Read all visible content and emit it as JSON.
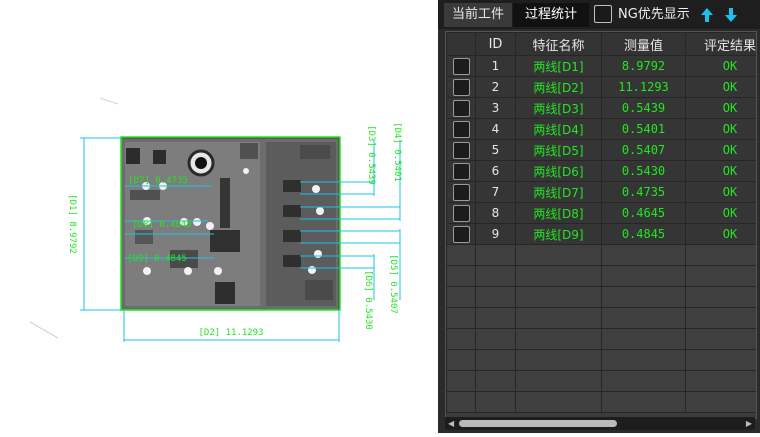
{
  "tabs": [
    {
      "label": "当前工件"
    },
    {
      "label": "过程统计"
    }
  ],
  "ng_toggle": {
    "label": "NG优先显示",
    "checked": false
  },
  "icons": {
    "up": "arrow-up-icon",
    "down": "arrow-down-icon"
  },
  "colors": {
    "ok_text": "#22e622",
    "annotation": "#22e622",
    "measure_line": "#19c3e6"
  },
  "table": {
    "headers": [
      "",
      "ID",
      "特征名称",
      "测量值",
      "评定结果"
    ],
    "rows": [
      {
        "id": "1",
        "name": "两线[D1]",
        "value": "8.9792",
        "result": "OK"
      },
      {
        "id": "2",
        "name": "两线[D2]",
        "value": "11.1293",
        "result": "OK"
      },
      {
        "id": "3",
        "name": "两线[D3]",
        "value": "0.5439",
        "result": "OK"
      },
      {
        "id": "4",
        "name": "两线[D4]",
        "value": "0.5401",
        "result": "OK"
      },
      {
        "id": "5",
        "name": "两线[D5]",
        "value": "0.5407",
        "result": "OK"
      },
      {
        "id": "6",
        "name": "两线[D6]",
        "value": "0.5430",
        "result": "OK"
      },
      {
        "id": "7",
        "name": "两线[D7]",
        "value": "0.4735",
        "result": "OK"
      },
      {
        "id": "8",
        "name": "两线[D8]",
        "value": "0.4645",
        "result": "OK"
      },
      {
        "id": "9",
        "name": "两线[D9]",
        "value": "0.4845",
        "result": "OK"
      }
    ]
  },
  "image_annotations": {
    "d1": "[D1] 8.9792",
    "d2": "[D2] 11.1293",
    "d3": "[D3] 0.5439",
    "d4": "[D4] 0.5401",
    "d5": "[D5] 0.5407",
    "d6": "[D6] 0.5430",
    "d7": "[D7] 0.4735",
    "d8": "[D8] 0.4645",
    "d9": "[D9] 0.4845"
  }
}
